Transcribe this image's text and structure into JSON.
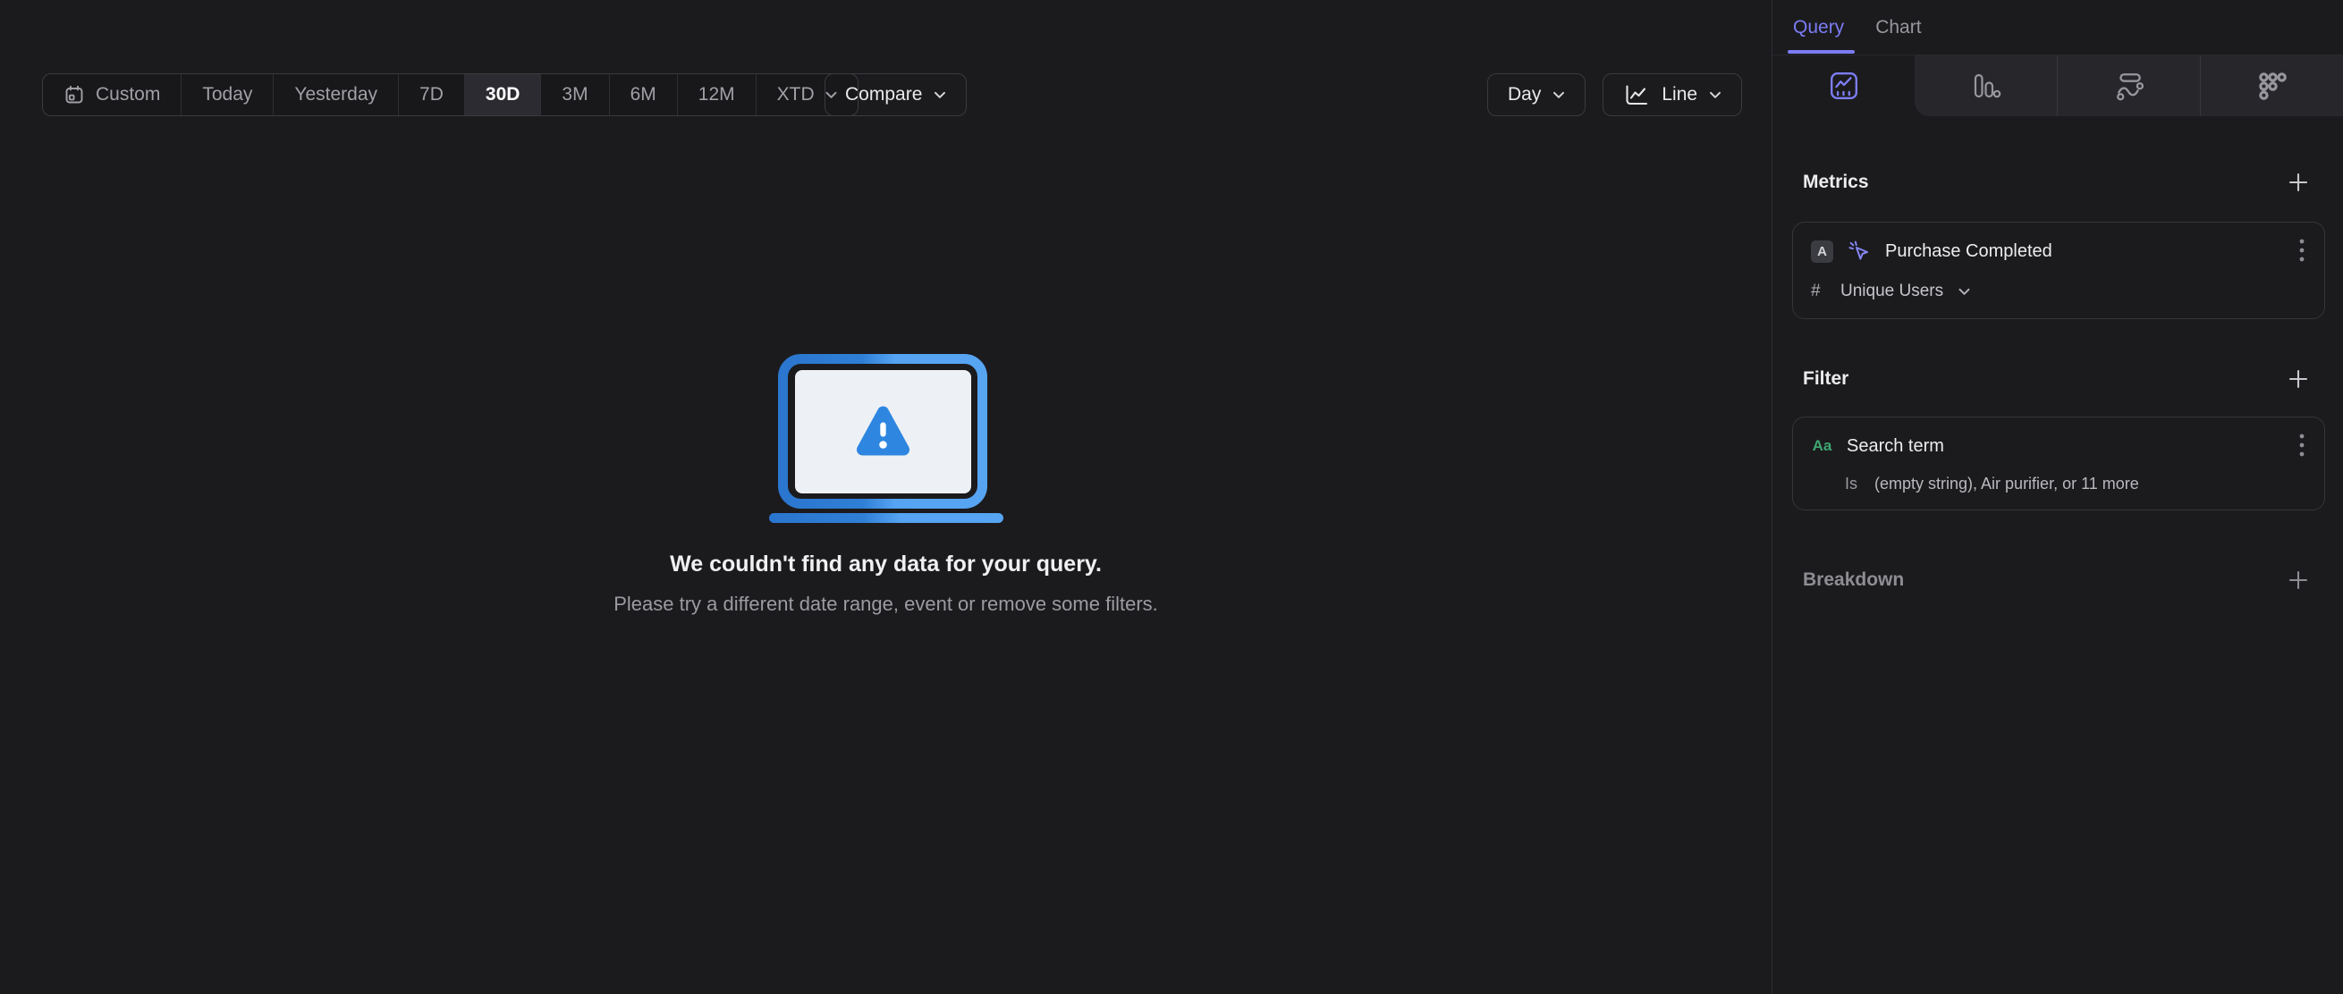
{
  "toolbar": {
    "date_ranges": [
      {
        "label": "Custom",
        "icon": "calendar-icon",
        "selected": false
      },
      {
        "label": "Today",
        "selected": false
      },
      {
        "label": "Yesterday",
        "selected": false
      },
      {
        "label": "7D",
        "selected": false
      },
      {
        "label": "30D",
        "selected": true
      },
      {
        "label": "3M",
        "selected": false
      },
      {
        "label": "6M",
        "selected": false
      },
      {
        "label": "12M",
        "selected": false
      },
      {
        "label": "XTD",
        "selected": false,
        "has_dropdown": true
      }
    ],
    "selected_range": "30D",
    "compare_label": "Compare",
    "interval_label": "Day",
    "chart_type_label": "Line",
    "chart_type_icon": "line-chart-icon"
  },
  "empty_state": {
    "title": "We couldn't find any data for your query.",
    "subtitle": "Please try a different date range, event or remove some filters."
  },
  "sidebar": {
    "tabs": [
      {
        "label": "Query",
        "active": true
      },
      {
        "label": "Chart",
        "active": false
      }
    ],
    "view_tabs": [
      {
        "icon": "insights-icon",
        "active": true
      },
      {
        "icon": "bar-chart-icon",
        "active": false
      },
      {
        "icon": "flows-icon",
        "active": false
      },
      {
        "icon": "retention-icon",
        "active": false
      }
    ],
    "metrics": {
      "heading": "Metrics",
      "items": [
        {
          "series_letter": "A",
          "event_icon": "event-click-icon",
          "event_name": "Purchase Completed",
          "aggregation_symbol": "#",
          "aggregation": "Unique Users"
        }
      ]
    },
    "filter": {
      "heading": "Filter",
      "items": [
        {
          "type_badge": "Aa",
          "property": "Search term",
          "operator": "Is",
          "values_summary": "(empty string), Air purifier, or 11 more"
        }
      ]
    },
    "breakdown": {
      "heading": "Breakdown"
    }
  },
  "colors": {
    "accent_purple": "#7c7cf4",
    "accent_green": "#3ea671",
    "illustration_blue_dark": "#2b76cf",
    "illustration_blue_light": "#57a5f2",
    "warning_triangle_blue": "#2e86e0"
  }
}
